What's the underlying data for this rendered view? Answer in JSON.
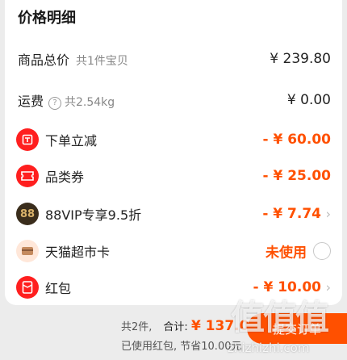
{
  "section_title": "价格明细",
  "rows": {
    "goods": {
      "label": "商品总价",
      "sub": "共1件宝贝",
      "amount": "¥ 239.80"
    },
    "shipping": {
      "label": "运费",
      "help": "?",
      "sub": "共2.54kg",
      "amount": "¥ 0.00"
    },
    "order_discount": {
      "label": "下单立减",
      "amount": "- ¥ 60.00",
      "icon": "red-coupon-icon"
    },
    "category_coupon": {
      "label": "品类券",
      "amount": "- ¥ 25.00",
      "icon": "ticket-icon"
    },
    "vip": {
      "label": "88VIP专享9.5折",
      "icon_text": "88",
      "amount": "- ¥ 7.74"
    },
    "tmall_card": {
      "label": "天猫超市卡",
      "amount": "未使用",
      "icon": "card-icon"
    },
    "red_packet": {
      "label": "红包",
      "amount": "- ¥ 10.00",
      "icon": "red-envelope-icon"
    }
  },
  "footer": {
    "count": "共2件,",
    "total_label": "合计:",
    "total": "¥ 137.06",
    "used_note": "已使用红包, 节省10.00元",
    "submit": "提交订单"
  },
  "watermark": {
    "main": "值值值",
    "url": "zhizhizhi.com"
  },
  "colors": {
    "accent": "#ff5000",
    "icon_red": "#ff1f1f",
    "vip_dark": "#3a2d1c"
  }
}
